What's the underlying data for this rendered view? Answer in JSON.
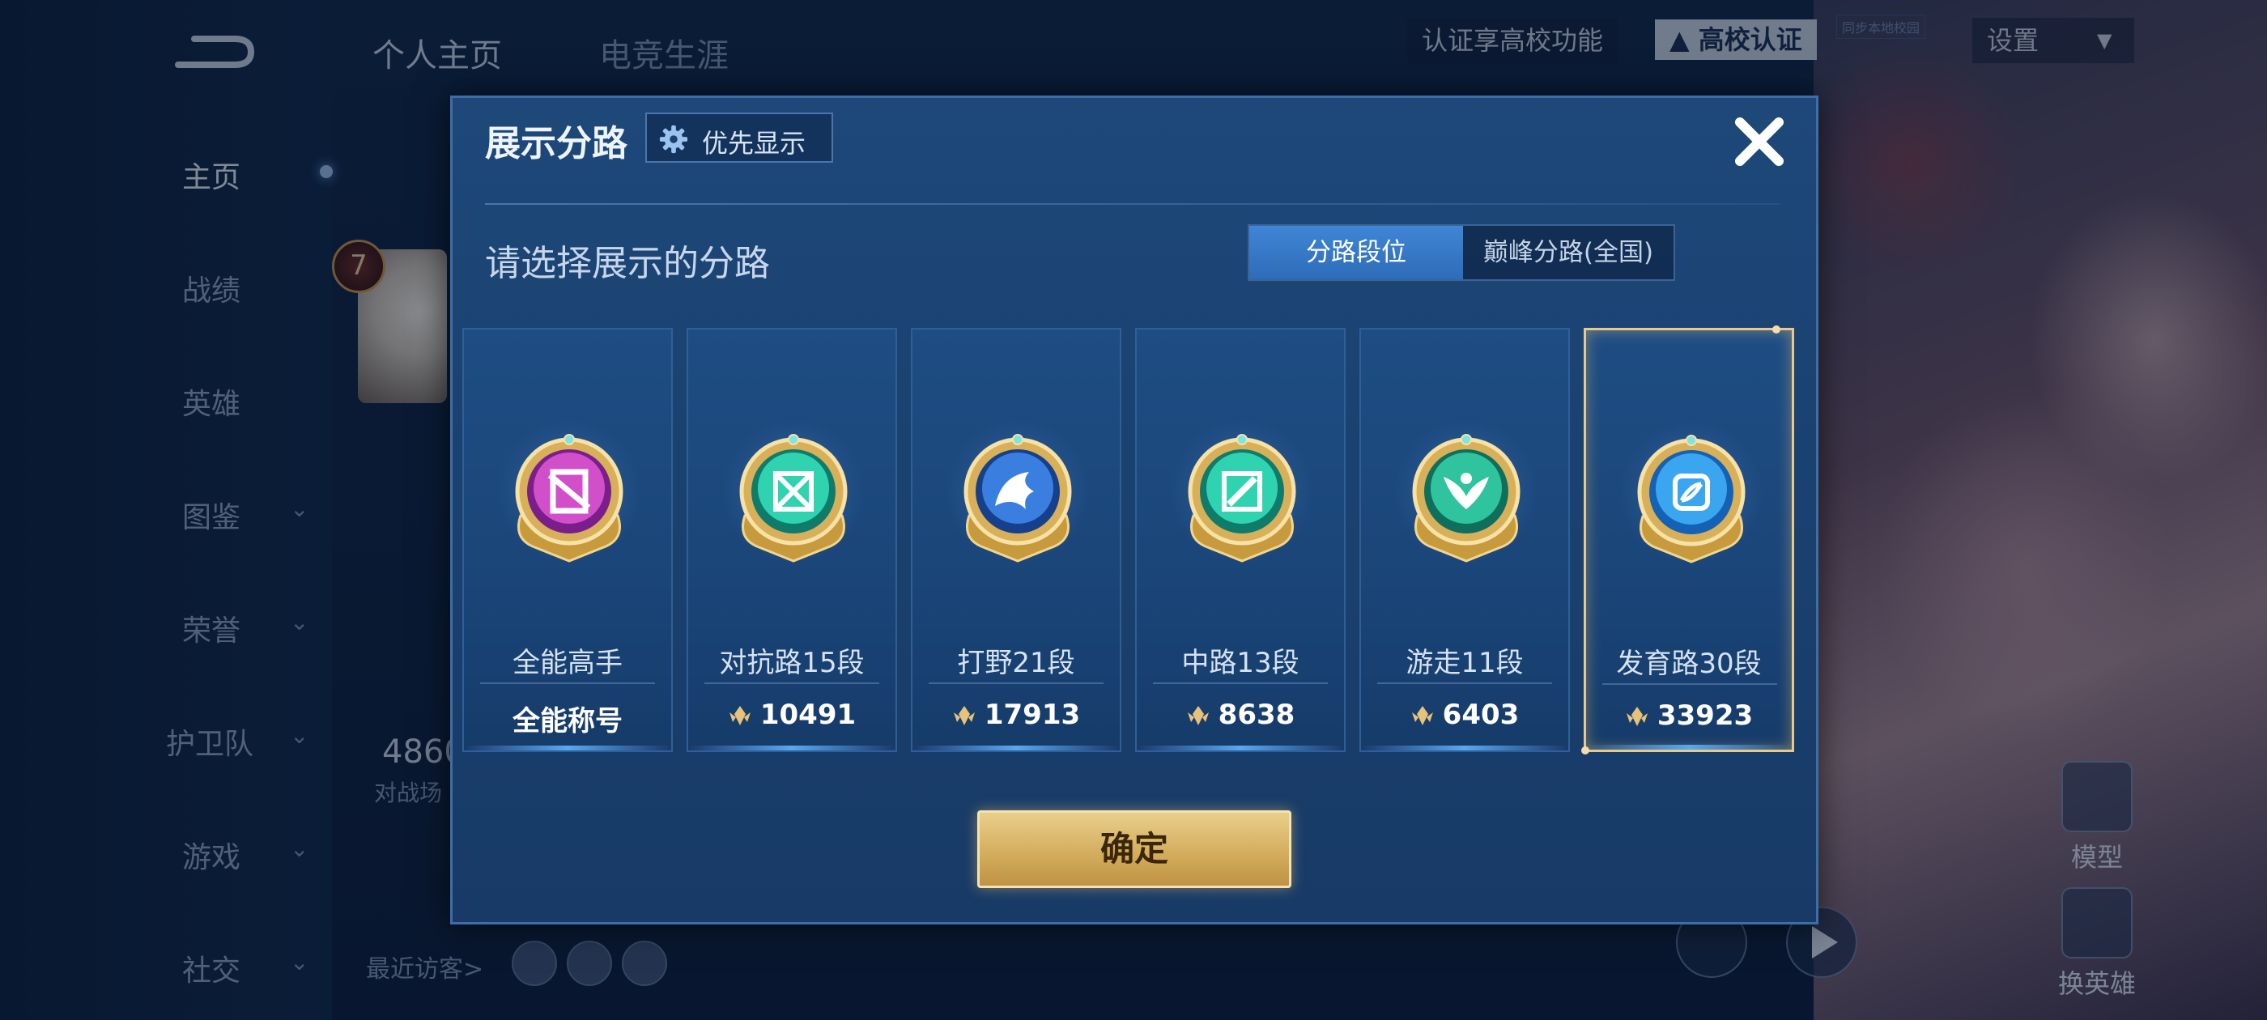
{
  "background": {
    "top_tabs": [
      "个人主页",
      "电竞生涯"
    ],
    "nav": [
      {
        "label": "主页",
        "has_chevron": false
      },
      {
        "label": "战绩",
        "has_chevron": false
      },
      {
        "label": "英雄",
        "has_chevron": false
      },
      {
        "label": "图鉴",
        "has_chevron": true
      },
      {
        "label": "荣誉",
        "has_chevron": true
      },
      {
        "label": "护卫队",
        "has_chevron": true
      },
      {
        "label": "游戏",
        "has_chevron": true
      },
      {
        "label": "社交",
        "has_chevron": true
      }
    ],
    "chevron": "⌄",
    "cert_hint": "认证享高校功能",
    "cert_badge": "高校认证",
    "tiny_tag": "同步本地校园",
    "settings": "设置",
    "level": "7",
    "stat_num": "4860",
    "stat_label": "对战场",
    "visitors_label": "最近访客>",
    "side_buttons": [
      "模型",
      "换英雄"
    ]
  },
  "dialog": {
    "title": "展示分路",
    "priority_button": "优先显示",
    "prompt": "请选择展示的分路",
    "segments": [
      {
        "label": "分路段位",
        "active": true
      },
      {
        "label": "巅峰分路(全国)",
        "active": false
      }
    ],
    "cards": [
      {
        "rank": "全能高手",
        "bottom": "全能称号",
        "has_score_icon": false,
        "selected": false,
        "colors": [
          "#d14fc8",
          "#7a1e8c"
        ]
      },
      {
        "rank": "对抗路15段",
        "bottom": "10491",
        "has_score_icon": true,
        "selected": false,
        "colors": [
          "#2fd3b0",
          "#0f7b6a"
        ]
      },
      {
        "rank": "打野21段",
        "bottom": "17913",
        "has_score_icon": true,
        "selected": false,
        "colors": [
          "#3a7fe0",
          "#163f8c"
        ]
      },
      {
        "rank": "中路13段",
        "bottom": "8638",
        "has_score_icon": true,
        "selected": false,
        "colors": [
          "#2fd3b0",
          "#0f7b6a"
        ]
      },
      {
        "rank": "游走11段",
        "bottom": "6403",
        "has_score_icon": true,
        "selected": false,
        "colors": [
          "#2fc49e",
          "#0f6f5c"
        ]
      },
      {
        "rank": "发育路30段",
        "bottom": "33923",
        "has_score_icon": true,
        "selected": true,
        "colors": [
          "#3aa6f0",
          "#1561b5"
        ]
      }
    ],
    "confirm_button": "确定"
  }
}
